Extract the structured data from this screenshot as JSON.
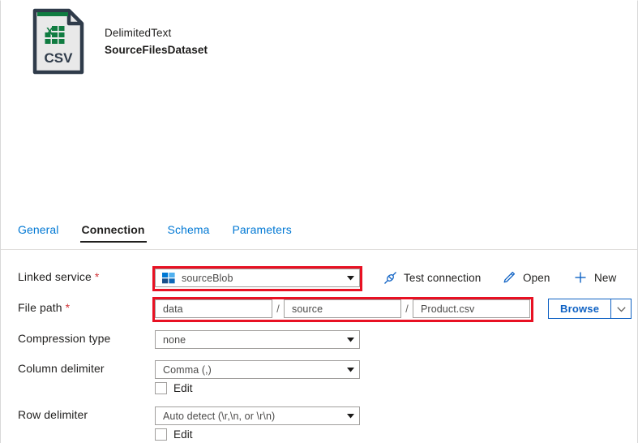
{
  "dataset": {
    "icon": "csv-file-icon",
    "icon_text": "CSV",
    "type_label": "DelimitedText",
    "name": "SourceFilesDataset"
  },
  "tabs": [
    {
      "label": "General",
      "active": false
    },
    {
      "label": "Connection",
      "active": true
    },
    {
      "label": "Schema",
      "active": false
    },
    {
      "label": "Parameters",
      "active": false
    }
  ],
  "form": {
    "linked_service": {
      "label": "Linked service",
      "required_marker": "*",
      "icon": "azure-blob-storage-icon",
      "value": "sourceBlob",
      "highlighted": true
    },
    "actions": [
      {
        "label": "Test connection",
        "icon": "plug-connection-icon"
      },
      {
        "label": "Open",
        "icon": "pencil-edit-icon"
      },
      {
        "label": "New",
        "icon": "plus-icon"
      }
    ],
    "file_path": {
      "label": "File path",
      "required_marker": "*",
      "container": "data",
      "directory": "source",
      "file_name": "Product.csv",
      "separator": "/",
      "highlighted": true,
      "browse_label": "Browse"
    },
    "compression_type": {
      "label": "Compression type",
      "value": "none"
    },
    "column_delimiter": {
      "label": "Column delimiter",
      "value": "Comma (,)",
      "edit_label": "Edit",
      "edit_checked": false
    },
    "row_delimiter": {
      "label": "Row delimiter",
      "value": "Auto detect (\\r,\\n, or \\r\\n)",
      "edit_label": "Edit",
      "edit_checked": false
    }
  },
  "colors": {
    "accent_blue": "#0078d4",
    "link_blue": "#0f62c4",
    "highlight_red": "#e81123",
    "required_red": "#d13438",
    "csv_green": "#107c41",
    "icon_dark": "#2f3b4a"
  }
}
